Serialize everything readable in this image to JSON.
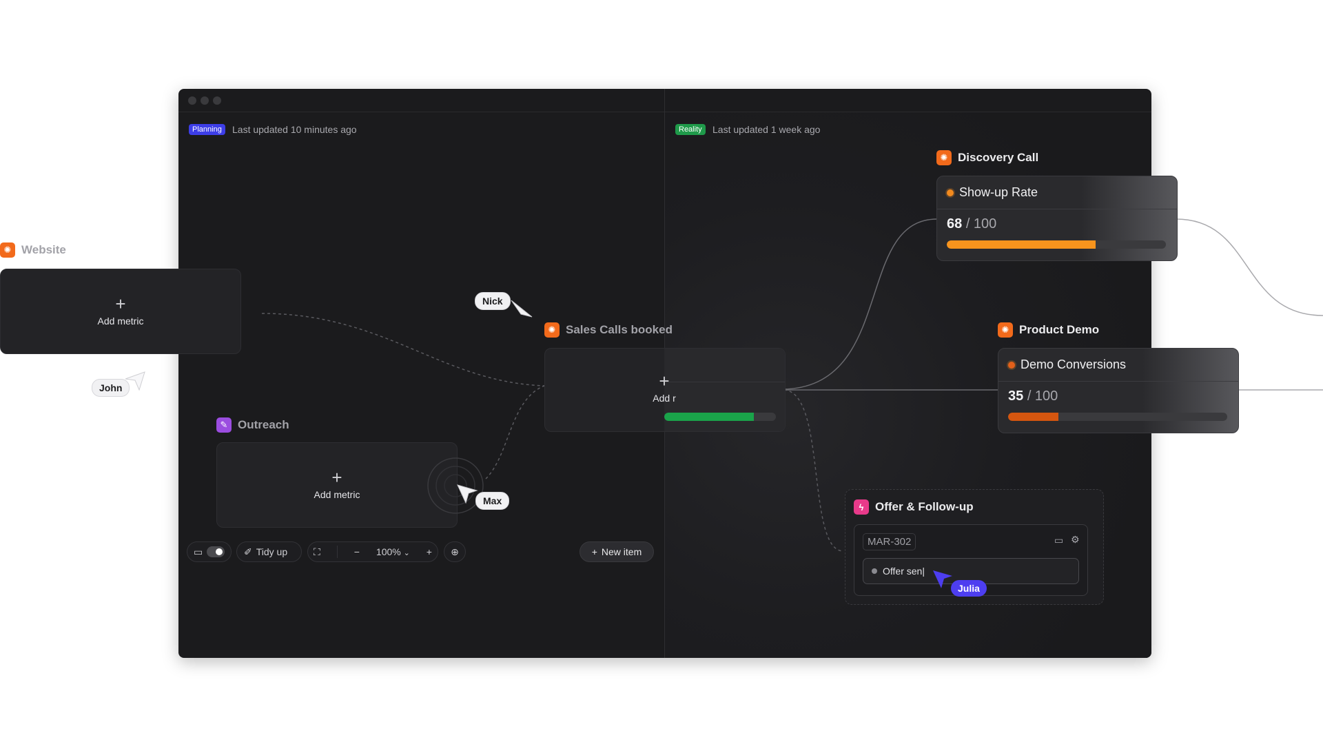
{
  "planning": {
    "badge": "Planning",
    "badge_color": "#3d3ee8",
    "updated": "Last updated 10 minutes ago"
  },
  "reality": {
    "badge": "Reality",
    "badge_color": "#1f9a4a",
    "updated": "Last updated 1 week ago"
  },
  "nodes": {
    "website": {
      "title": "Website",
      "add_label": "Add metric"
    },
    "outreach": {
      "title": "Outreach",
      "add_label": "Add metric"
    },
    "sales_calls": {
      "title": "Sales Calls booked",
      "add_label": "Add r",
      "bar_color": "#1aa34a"
    },
    "discovery": {
      "title": "Discovery Call",
      "metric": {
        "name": "Show-up Rate",
        "value": "68",
        "total": "/ 100",
        "progress": 0.68,
        "bar_color": "#f7941d"
      }
    },
    "product_demo": {
      "title": "Product Demo",
      "metric": {
        "name": "Demo Conversions",
        "value": "35",
        "total": "/ 100",
        "progress": 0.23,
        "bar_color": "#d5560f"
      }
    },
    "offer": {
      "title": "Offer & Follow-up",
      "code": "MAR-302",
      "input_value": "Offer sen|",
      "icons": [
        "archive-icon",
        "gear-icon"
      ]
    }
  },
  "cursors": {
    "nick": "Nick",
    "john": "John",
    "max": "Max",
    "julia": "Julia",
    "julia_color": "#4d3ef0"
  },
  "toolbar": {
    "tidy_up": "Tidy up",
    "zoom": "100%",
    "new_item": "New item"
  }
}
